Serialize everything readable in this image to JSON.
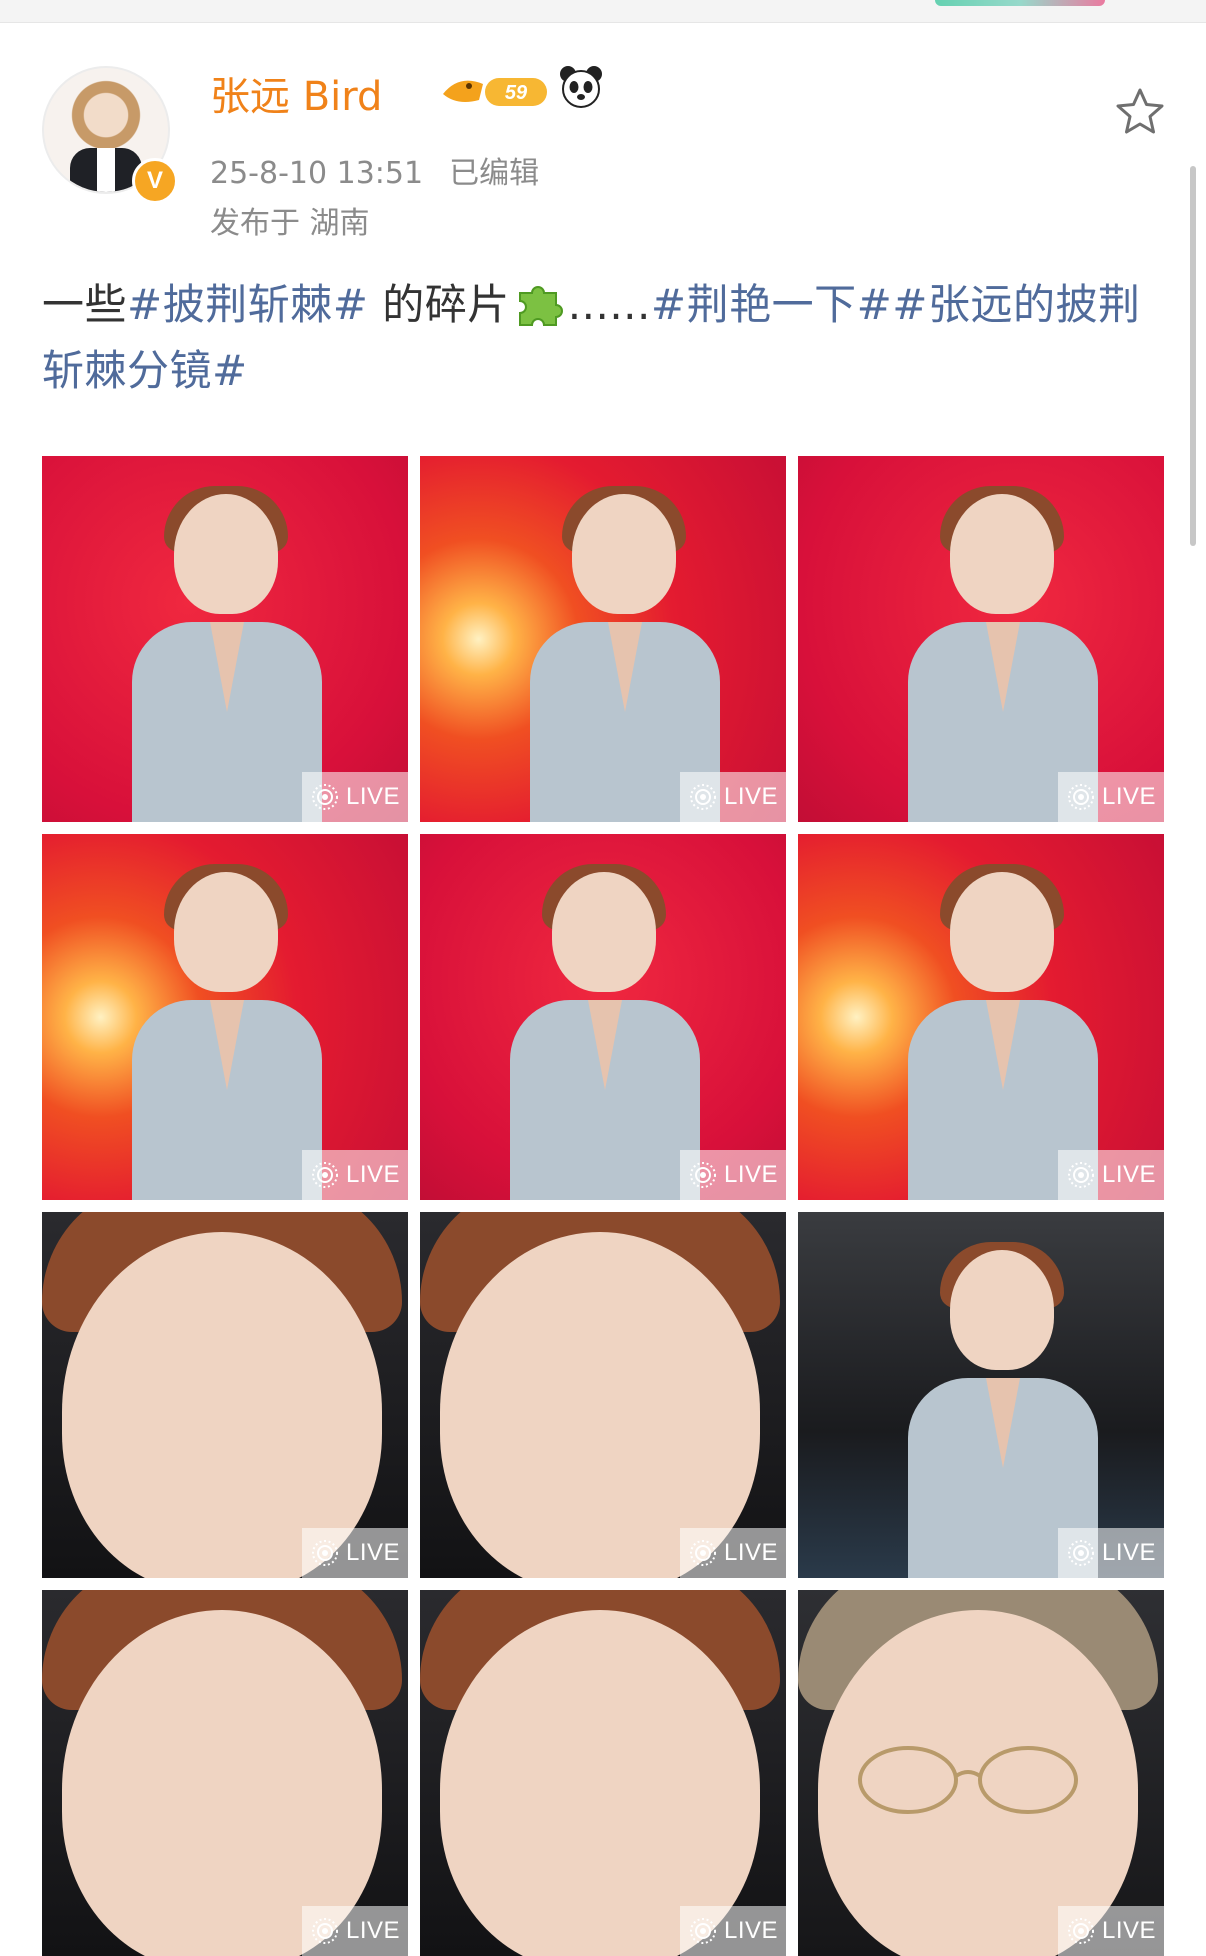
{
  "post": {
    "author": "张远 Bird",
    "vip_level": "59",
    "timestamp": "25-8-10 13:51",
    "edited": "已编辑",
    "location": "发布于 湖南",
    "text": {
      "prefix": "一些",
      "tag1": "#披荆斩棘#",
      "middle": " 的碎片",
      "ellipsis": "......",
      "tag2": "#荆艳一下#",
      "tag3": "#张远的披荆斩棘分镜#"
    }
  },
  "colors": {
    "name": "#f08219",
    "tag": "#506b9b",
    "meta": "#8b8b8b",
    "verified_badge": "#f6a623"
  },
  "icons": {
    "avatar": "avatar-photo",
    "verified": "verified-v-badge",
    "vip": "vip-shrimp-badge",
    "panda": "panda-emoji",
    "favorite": "star-outline-icon",
    "puzzle": "puzzle-piece-emoji",
    "live": "live-photo-icon"
  },
  "images": [
    {
      "live_label": "LIVE",
      "scene": "red-studio"
    },
    {
      "live_label": "LIVE",
      "scene": "red-orange-glow"
    },
    {
      "live_label": "LIVE",
      "scene": "red-studio"
    },
    {
      "live_label": "LIVE",
      "scene": "red-orange-glow"
    },
    {
      "live_label": "LIVE",
      "scene": "red-studio"
    },
    {
      "live_label": "LIVE",
      "scene": "red-orange-glow"
    },
    {
      "live_label": "LIVE",
      "scene": "backstage-closeup"
    },
    {
      "live_label": "LIVE",
      "scene": "backstage-closeup"
    },
    {
      "live_label": "LIVE",
      "scene": "backstage"
    },
    {
      "live_label": "LIVE",
      "scene": "backstage-closeup"
    },
    {
      "live_label": "LIVE",
      "scene": "backstage-closeup"
    },
    {
      "live_label": "LIVE",
      "scene": "backstage-glasses"
    }
  ]
}
